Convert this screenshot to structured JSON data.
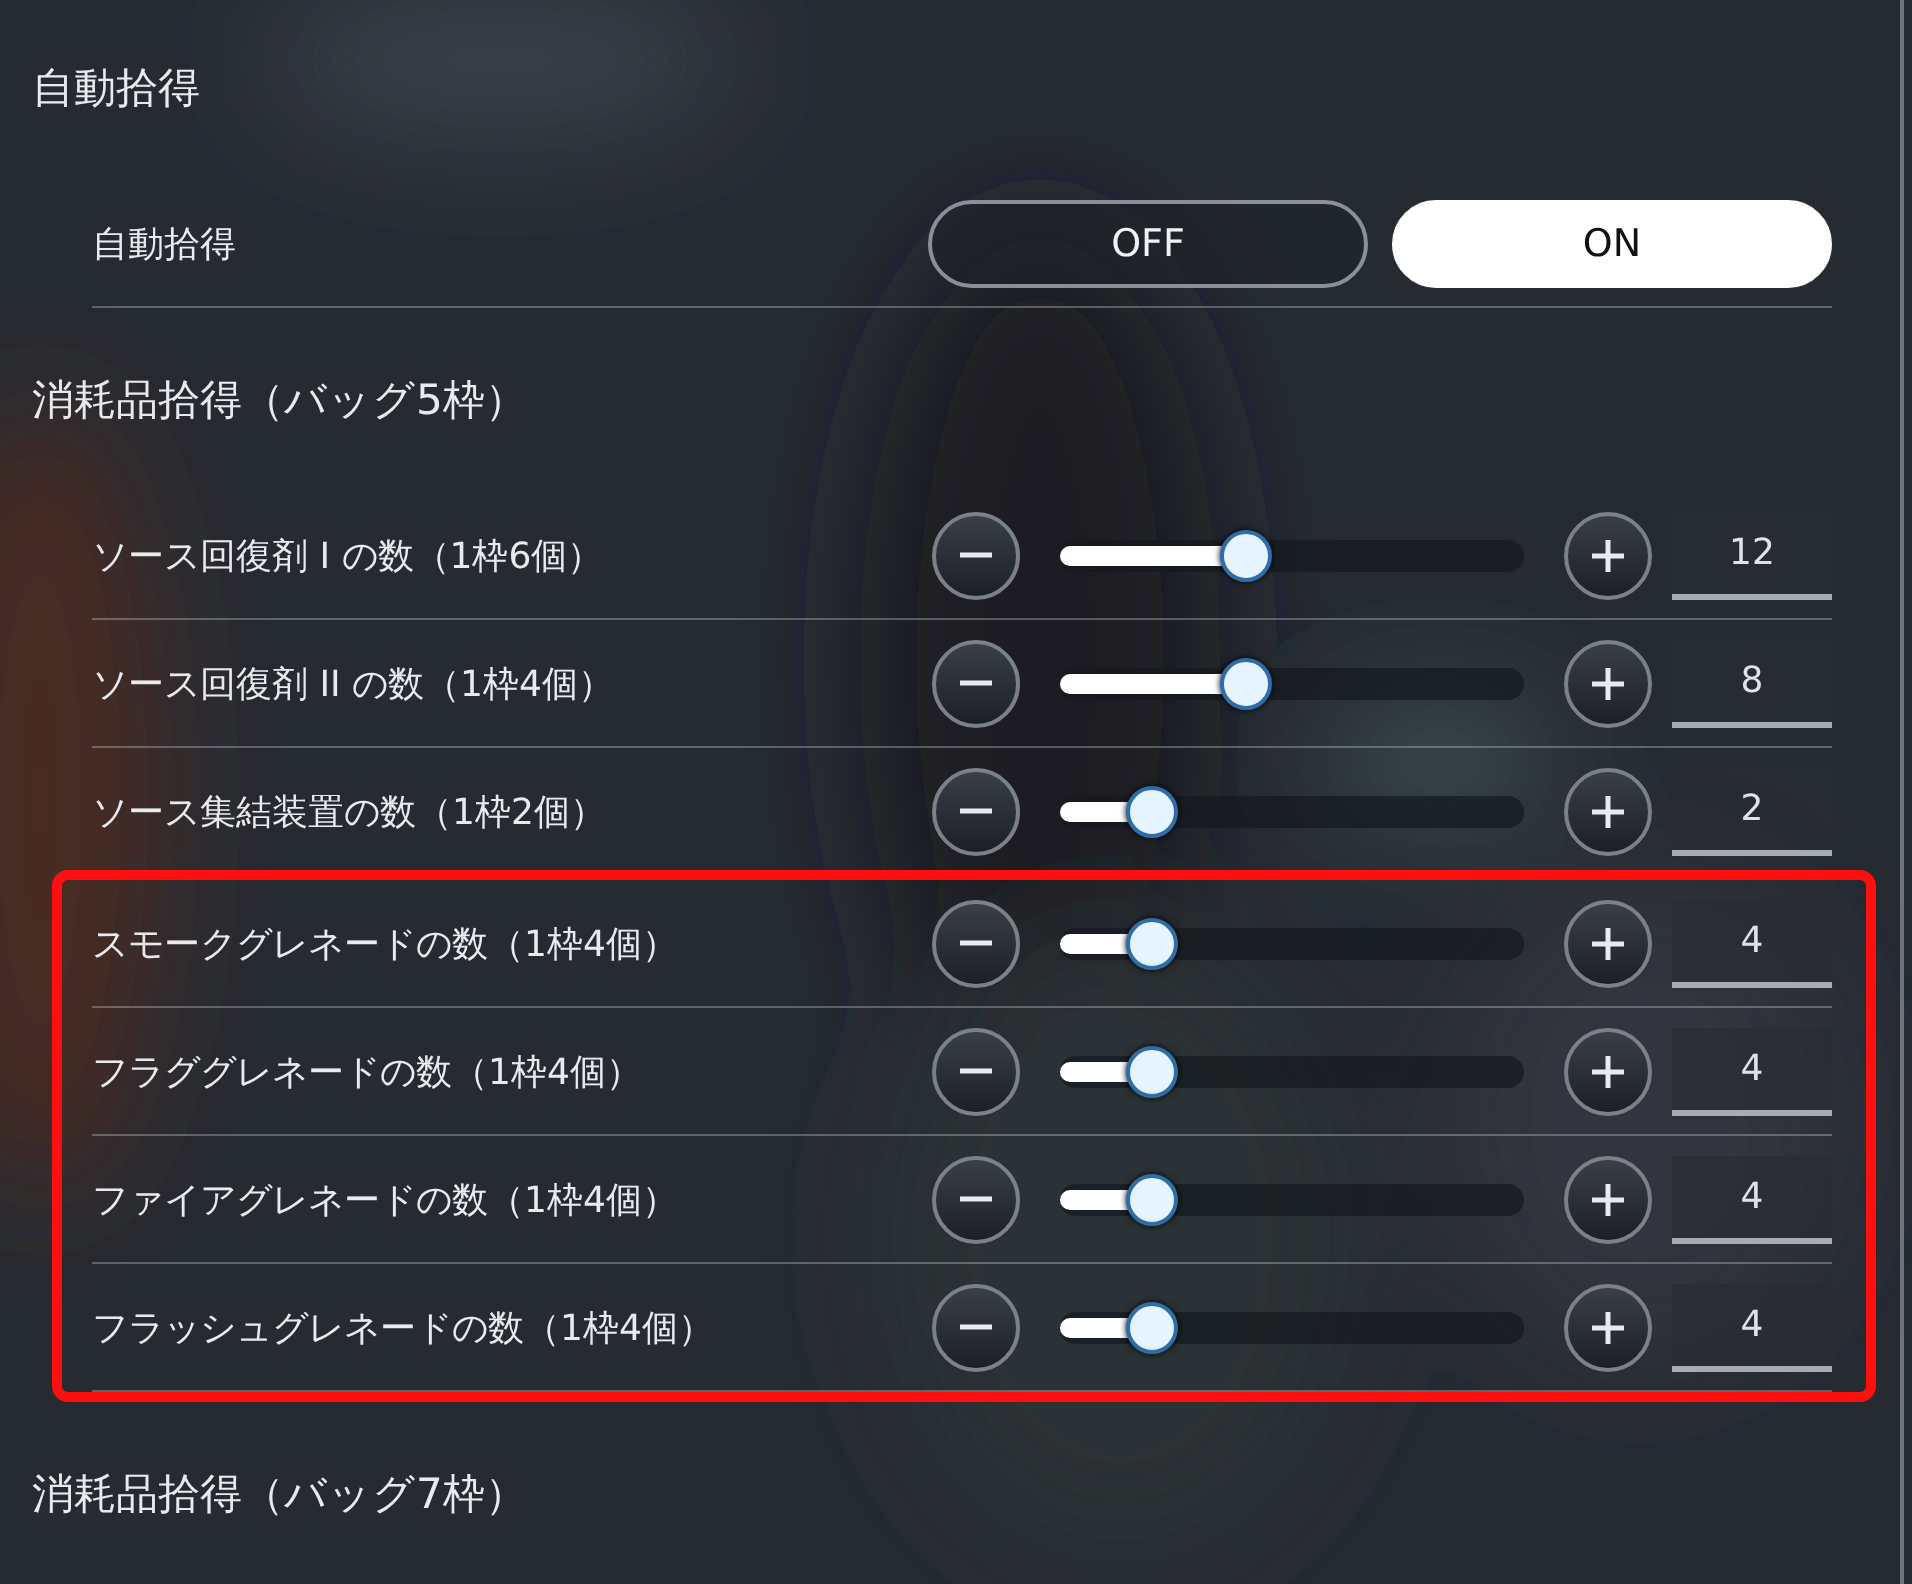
{
  "sections": [
    {
      "title": "自動拾得",
      "rows": [
        {
          "kind": "toggle",
          "label": "自動拾得",
          "options": [
            {
              "label": "OFF",
              "selected": false
            },
            {
              "label": "ON",
              "selected": true
            }
          ]
        }
      ]
    },
    {
      "title": "消耗品拾得（バッグ5枠）",
      "rows": [
        {
          "kind": "slider",
          "label": "ソース回復剤 I の数（1枠6個）",
          "level": 0.4,
          "value": "12"
        },
        {
          "kind": "slider",
          "label": "ソース回復剤 II の数（1枠4個）",
          "level": 0.4,
          "value": "8"
        },
        {
          "kind": "slider",
          "label": "ソース集結装置の数（1枠2個）",
          "level": 0.2,
          "value": "2"
        },
        {
          "kind": "highlight_frame",
          "rows": [
            {
              "kind": "slider",
              "label": "スモークグレネードの数（1枠4個）",
              "level": 0.2,
              "value": "4"
            },
            {
              "kind": "slider",
              "label": "フラググレネードの数（1枠4個）",
              "level": 0.2,
              "value": "4"
            },
            {
              "kind": "slider",
              "label": "ファイアグレネードの数（1枠4個）",
              "level": 0.2,
              "value": "4"
            },
            {
              "kind": "slider",
              "label": "フラッシュグレネードの数（1枠4個）",
              "level": 0.2,
              "value": "4"
            }
          ]
        }
      ]
    },
    {
      "title": "消耗品拾得（バッグ7枠）"
    }
  ]
}
